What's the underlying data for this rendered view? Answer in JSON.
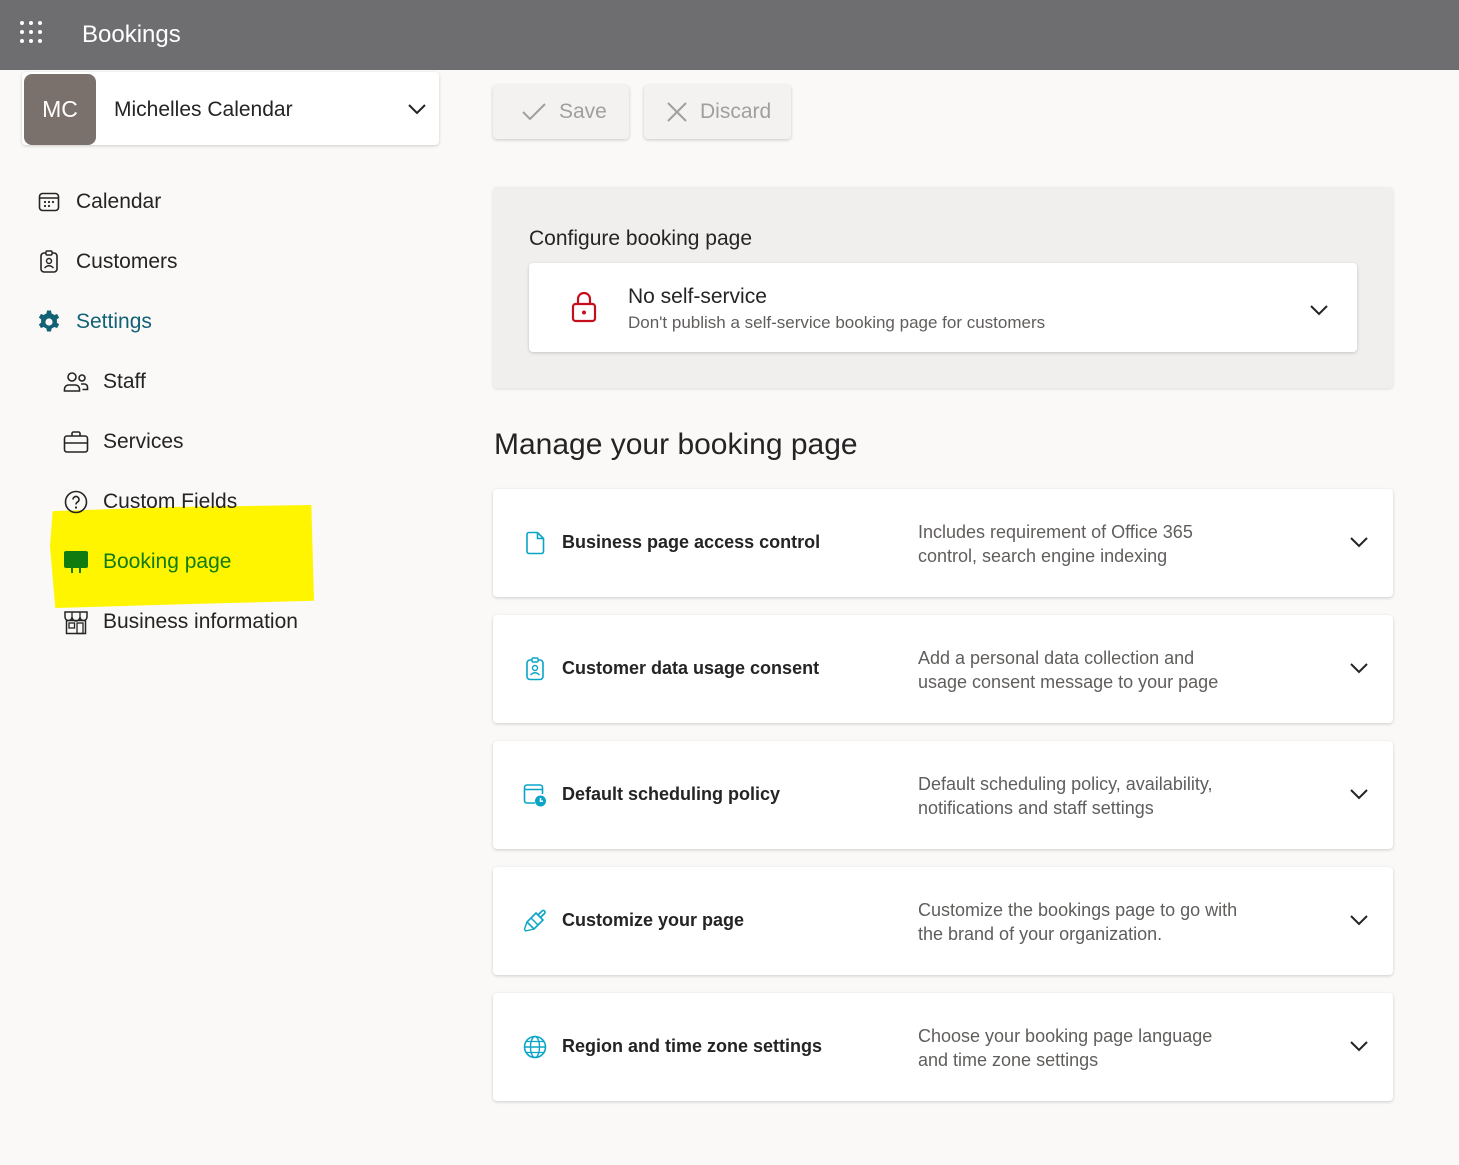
{
  "app": {
    "title": "Bookings"
  },
  "calendar_selector": {
    "initials": "MC",
    "name": "Michelles Calendar"
  },
  "nav": {
    "calendar": "Calendar",
    "customers": "Customers",
    "settings": "Settings",
    "staff": "Staff",
    "services": "Services",
    "custom_fields": "Custom Fields",
    "booking_page": "Booking page",
    "business_information": "Business information"
  },
  "toolbar": {
    "save_label": "Save",
    "discard_label": "Discard"
  },
  "configure": {
    "title": "Configure booking page",
    "selected_title": "No self-service",
    "selected_description": "Don't publish a self-service booking page for customers"
  },
  "manage": {
    "title": "Manage your booking page",
    "items": [
      {
        "title": "Business page access control",
        "description": "Includes requirement of Office 365 control, search engine indexing"
      },
      {
        "title": "Customer data usage consent",
        "description": "Add a personal data collection and usage consent message to your page"
      },
      {
        "title": "Default scheduling policy",
        "description": "Default scheduling policy, availability, notifications and staff settings"
      },
      {
        "title": "Customize your page",
        "description": "Customize the bookings page to go with the brand of your organization."
      },
      {
        "title": "Region and time zone settings",
        "description": "Choose your booking page language and time zone settings"
      }
    ]
  },
  "colors": {
    "topbar": "#6e6e70",
    "accent_teal": "#116275",
    "active_green": "#107c10",
    "highlight": "#fff500",
    "lock_red": "#c50f1f",
    "row_icon": "#0aa5c6"
  }
}
